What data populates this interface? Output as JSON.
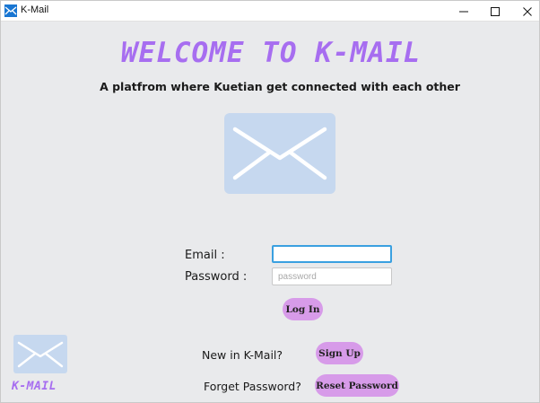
{
  "window": {
    "title": "K-Mail",
    "icon": "mail-envelope-icon",
    "controls": [
      "minimize-icon",
      "maximize-icon",
      "close-icon"
    ]
  },
  "header": {
    "headline": "WELCOME TO K-MAIL",
    "subtitle": "A platfrom where Kuetian get connected with each other"
  },
  "login": {
    "email_label": "Email :",
    "email_value": "",
    "email_placeholder": "",
    "password_label": "Password :",
    "password_value": "",
    "password_placeholder": "password",
    "login_button": "Log In"
  },
  "signup": {
    "prompt": "New in K-Mail?",
    "button": "Sign Up"
  },
  "reset": {
    "prompt": "Forget Password?",
    "button": "Reset Password"
  },
  "brand": {
    "small_label": "K-MAIL"
  },
  "colors": {
    "accent_purple": "#a76ef0",
    "button_pill": "#d79be9",
    "logo_bg": "#c6d8ef",
    "focus_border": "#3aa0e0",
    "window_bg": "#e9eaec"
  }
}
